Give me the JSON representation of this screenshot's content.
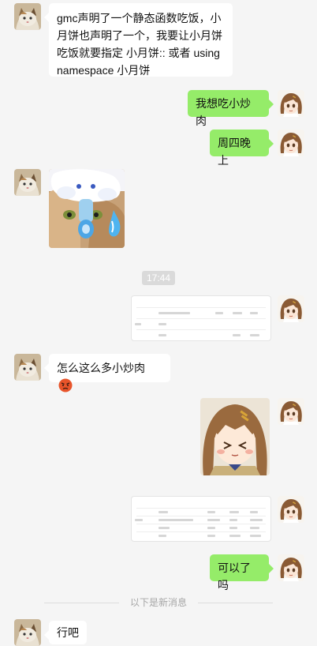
{
  "messages": {
    "m1": "gmc声明了一个静态函数吃饭，小月饼也声明了一个，我要让小月饼吃饭就要指定 小月饼:: 或者 using namespace 小月饼",
    "m2": "我想吃小炒肉",
    "m3": "周四晚上",
    "m4": "怎么这么多小炒肉",
    "m5": "可以了吗",
    "m6": "行吧"
  },
  "time_divider": "17:44",
  "new_messages_divider": "以下是新消息",
  "icons": {
    "left_avatar": "cat-avatar-icon",
    "right_avatar": "anime-girl-avatar-icon",
    "emoji": "angry-face-icon",
    "sticker_left": "cat-with-pacifier-sticker",
    "sticker_right": "anime-girl-sticker"
  },
  "colors": {
    "background": "#f5f5f5",
    "incoming_bubble": "#ffffff",
    "outgoing_bubble": "#95ec69",
    "time_badge": "#dadada"
  }
}
